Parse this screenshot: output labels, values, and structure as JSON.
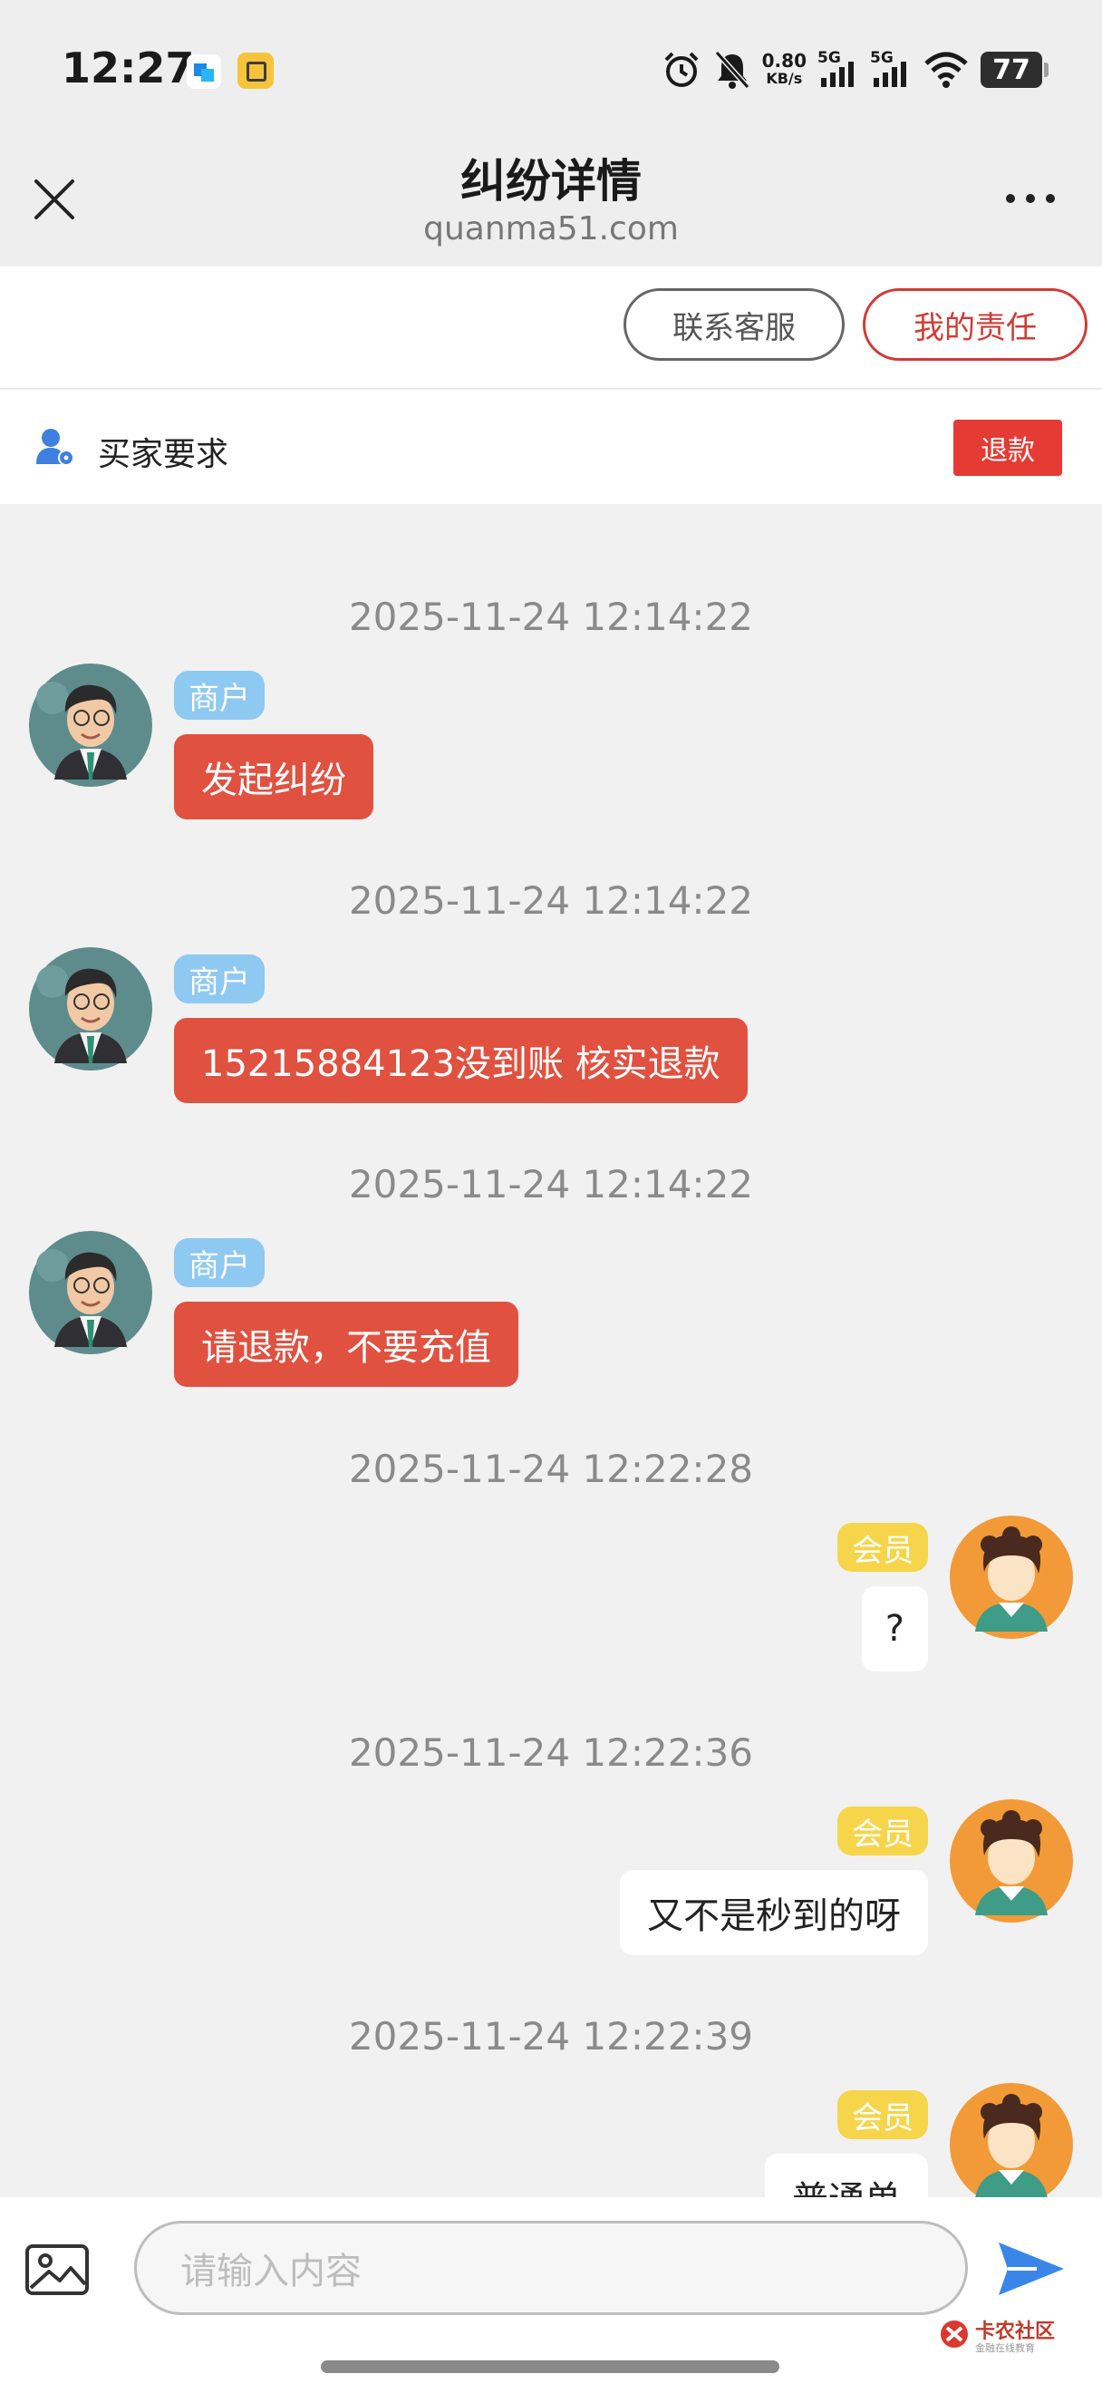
{
  "status": {
    "time": "12:27",
    "speed_value": "0.80",
    "speed_unit": "KB/s",
    "sim1": "5G",
    "sim2": "5G",
    "battery": "77"
  },
  "header": {
    "title": "纠纷详情",
    "domain": "quanma51.com"
  },
  "actions": {
    "contact_service": "联系客服",
    "my_responsibility": "我的责任"
  },
  "request": {
    "label": "买家要求",
    "badge": "退款"
  },
  "messages": [
    {
      "time": "2025-11-24 12:14:22",
      "side": "left",
      "role": "商户",
      "text": "发起纠纷"
    },
    {
      "time": "2025-11-24 12:14:22",
      "side": "left",
      "role": "商户",
      "text": "15215884123没到账 核实退款"
    },
    {
      "time": "2025-11-24 12:14:22",
      "side": "left",
      "role": "商户",
      "text": "请退款，不要充值"
    },
    {
      "time": "2025-11-24 12:22:28",
      "side": "right",
      "role": "会员",
      "text": "?"
    },
    {
      "time": "2025-11-24 12:22:36",
      "side": "right",
      "role": "会员",
      "text": "又不是秒到的呀"
    },
    {
      "time": "2025-11-24 12:22:39",
      "side": "right",
      "role": "会员",
      "text": "普通单"
    }
  ],
  "composer": {
    "placeholder": "请输入内容"
  },
  "watermark": {
    "title": "卡农社区",
    "subtitle": "金融在线教育"
  },
  "colors": {
    "merchant_bubble": "#e05140",
    "member_bubble": "#ffffff",
    "merchant_tag": "#8ec9f2",
    "member_tag": "#f6d54a",
    "accent_red": "#d23a34"
  }
}
